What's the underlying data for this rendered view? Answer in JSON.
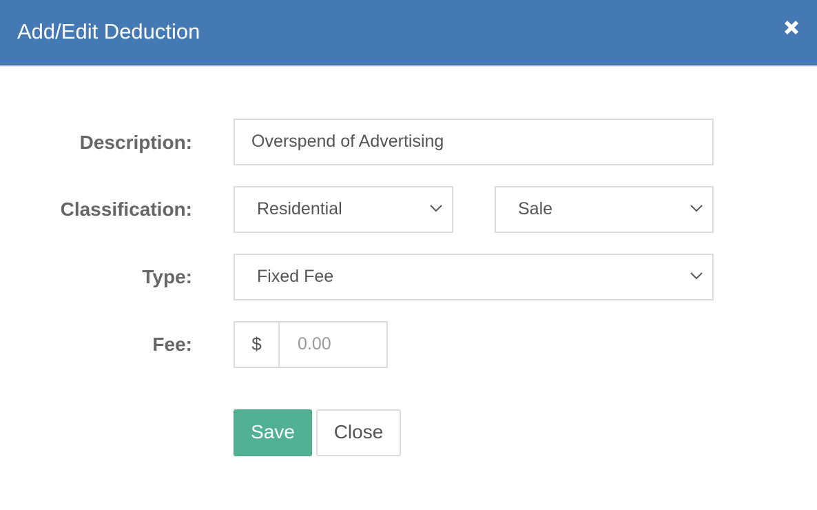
{
  "modal": {
    "title": "Add/Edit Deduction",
    "close_icon": "close-icon",
    "header_color": "#4479b3"
  },
  "form": {
    "description": {
      "label": "Description:",
      "value": "Overspend of Advertising"
    },
    "classification": {
      "label": "Classification:",
      "category_value": "Residential",
      "transaction_value": "Sale"
    },
    "type": {
      "label": "Type:",
      "value": "Fixed Fee"
    },
    "fee": {
      "label": "Fee:",
      "currency_symbol": "$",
      "placeholder": "0.00"
    }
  },
  "actions": {
    "save_label": "Save",
    "close_label": "Close",
    "save_color": "#52b093"
  }
}
